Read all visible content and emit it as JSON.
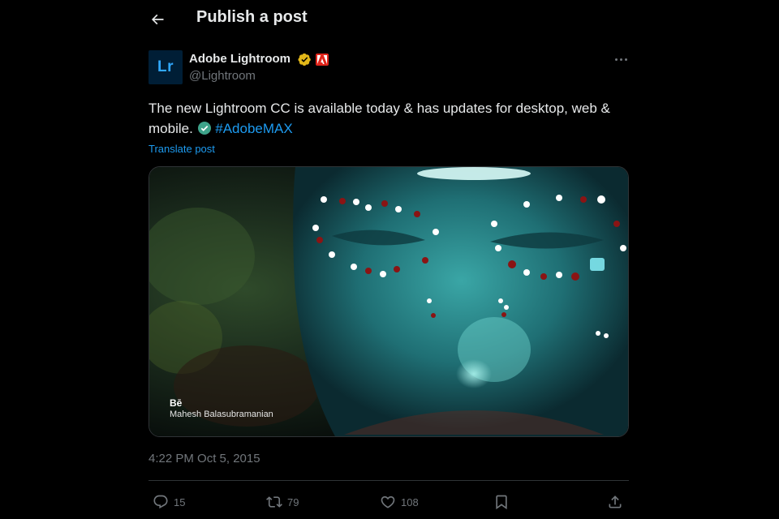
{
  "header": {
    "title": "Publish a post"
  },
  "author": {
    "avatar_text": "Lr",
    "name": "Adobe Lightroom",
    "handle": "@Lightroom",
    "verified_color": "#e2b719",
    "affiliate_color": "#e1251b"
  },
  "post": {
    "text_before": "The new Lightroom CC is available today & has updates for desktop, web & mobile. ",
    "hashtag": "#AdobeMAX",
    "translate_label": "Translate post"
  },
  "media": {
    "logo": "Bē",
    "credit": "Mahesh Balasubramanian"
  },
  "timestamp": "4:22 PM Oct 5, 2015",
  "actions": {
    "replies": "15",
    "reposts": "79",
    "likes": "108"
  },
  "colors": {
    "background": "#000000",
    "text": "#e7e9ea",
    "muted": "#71767b",
    "link": "#1d9bf0",
    "border": "#2f3336"
  }
}
